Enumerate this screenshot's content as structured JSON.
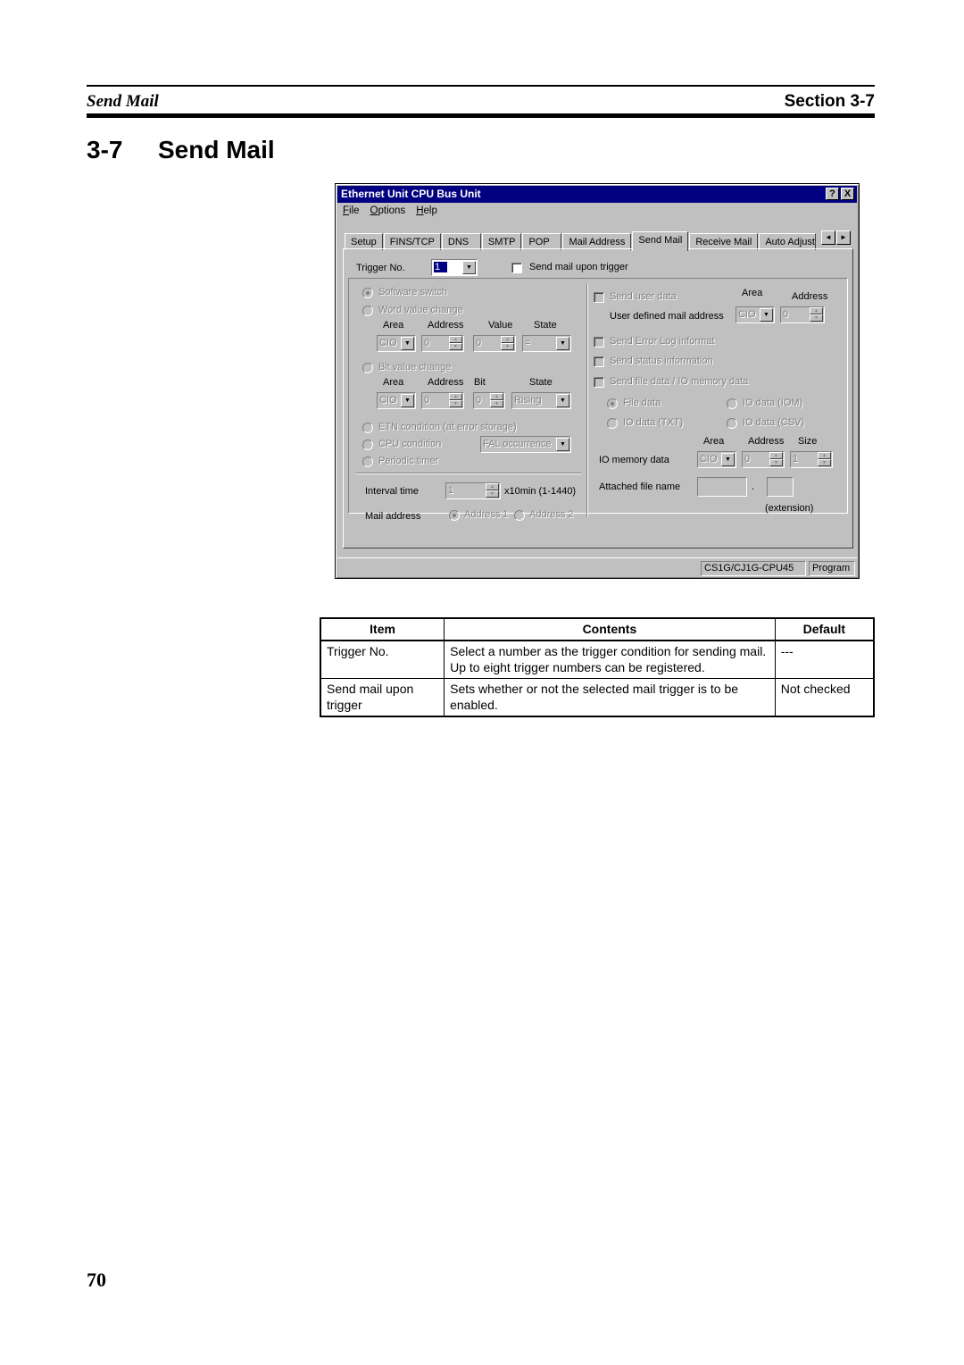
{
  "header": {
    "left": "Send Mail",
    "right": "Section 3-7"
  },
  "heading": {
    "number": "3-7",
    "title": "Send Mail"
  },
  "window": {
    "title": "Ethernet Unit CPU Bus Unit",
    "help_btn": "?",
    "close_btn": "X",
    "menu": [
      "File",
      "Options",
      "Help"
    ],
    "tabs": [
      "Setup",
      "FINS/TCP",
      "DNS",
      "SMTP",
      "POP",
      "Mail Address",
      "Send Mail",
      "Receive Mail",
      "Auto Adjust"
    ],
    "active_tab": "Send Mail",
    "tab_scroll_left": "◄",
    "tab_scroll_right": "►",
    "trigger_no_label": "Trigger No.",
    "trigger_no_value": "1",
    "send_upon_trigger_label": "Send mail upon trigger",
    "left": {
      "software_switch": "Software switch",
      "word_value_change": "Word value change",
      "word_cols": {
        "area": "Area",
        "address": "Address",
        "value": "Value",
        "state": "State"
      },
      "word_vals": {
        "area": "CIO",
        "address": "0",
        "value": "0",
        "state": "="
      },
      "bit_value_change": "Bit value change",
      "bit_cols": {
        "area": "Area",
        "address": "Address",
        "bit": "Bit",
        "state": "State"
      },
      "bit_vals": {
        "area": "CIO",
        "address": "0",
        "bit": "0",
        "state": "Rising"
      },
      "etn_condition": "ETN condition (at error storage)",
      "cpu_condition": "CPU condition",
      "cpu_condition_value": "FAL occurrence",
      "periodic_timer": "Periodic timer",
      "interval_label": "Interval time",
      "interval_value": "1",
      "interval_unit": "x10min (1-1440)",
      "mail_address_label": "Mail address",
      "address1": "Address 1",
      "address2": "Address 2"
    },
    "right": {
      "send_user_data": "Send user data",
      "area_label": "Area",
      "address_label": "Address",
      "user_mail_addr_label": "User defined mail address",
      "user_area_val": "CIO",
      "user_addr_val": "0",
      "send_error_log": "Send Error Log informat",
      "send_status": "Send status information",
      "send_file_data": "Send file data / IO memory data",
      "file_data": "File data",
      "io_iom": "IO data (IOM)",
      "io_txt": "IO data (TXT)",
      "io_csv": "IO data (CSV)",
      "io_cols": {
        "area": "Area",
        "address": "Address",
        "size": "Size"
      },
      "io_memory_label": "IO memory data",
      "io_vals": {
        "area": "CIO",
        "address": "0",
        "size": "1"
      },
      "attached_file_label": "Attached file name",
      "dot": ".",
      "extension_label": "(extension)"
    },
    "status": {
      "model": "CS1G/CJ1G-CPU45",
      "mode": "Program"
    }
  },
  "table": {
    "headers": [
      "Item",
      "Contents",
      "Default"
    ],
    "rows": [
      {
        "item": "Trigger No.",
        "contents": "Select a number as the trigger condition for sending mail. Up to eight trigger numbers can be registered.",
        "default": "---"
      },
      {
        "item": "Send mail upon trigger",
        "contents": "Sets whether or not the selected mail trigger is to be enabled.",
        "default": "Not checked"
      }
    ]
  },
  "page_number": "70"
}
